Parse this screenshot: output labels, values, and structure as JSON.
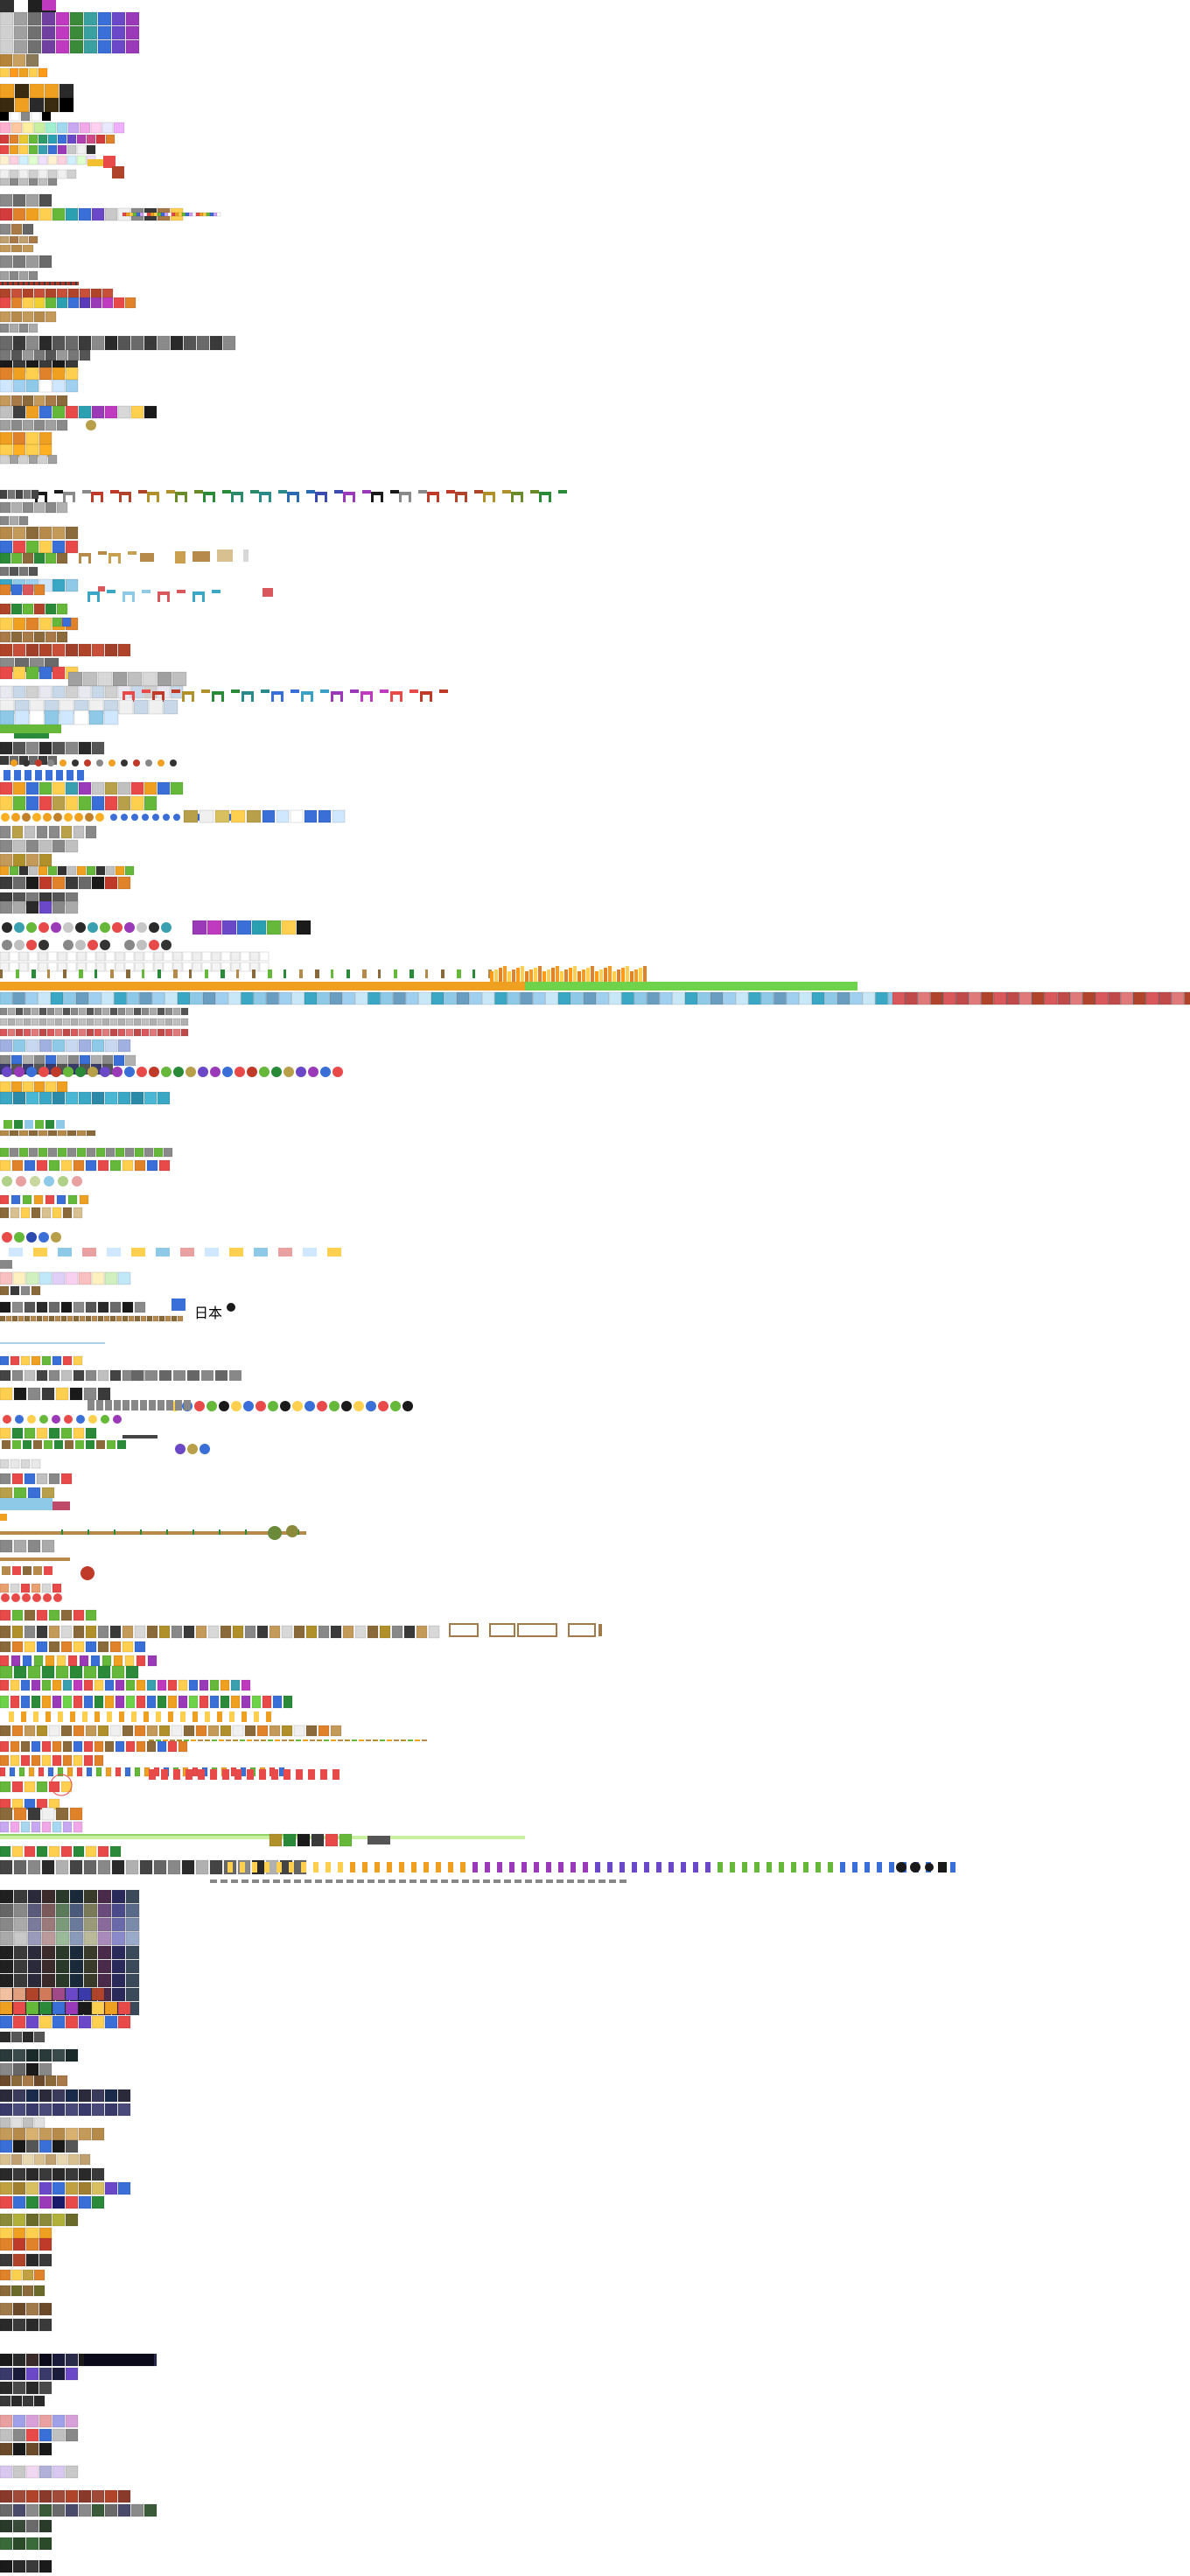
{
  "atlas": {
    "background": "#ffffff",
    "texts": [
      {
        "id": "kanji",
        "text": "日本"
      }
    ]
  },
  "palette": {
    "stone": "#8a8a8a",
    "stone_dark": "#4a4a4a",
    "blue_block": "#3a6fd8",
    "orange": "#f0a020",
    "green_grass": "#6ed24a",
    "fire": "#ff9a1a",
    "brick_red": "#b0442a",
    "ice_blue": "#8ec9e8",
    "sign_red": "#d9585c",
    "teal_glass": "#3aa7c4",
    "purple": "#9b3ab8",
    "wood": "#b58a4a",
    "night_dark": "#20202a"
  }
}
